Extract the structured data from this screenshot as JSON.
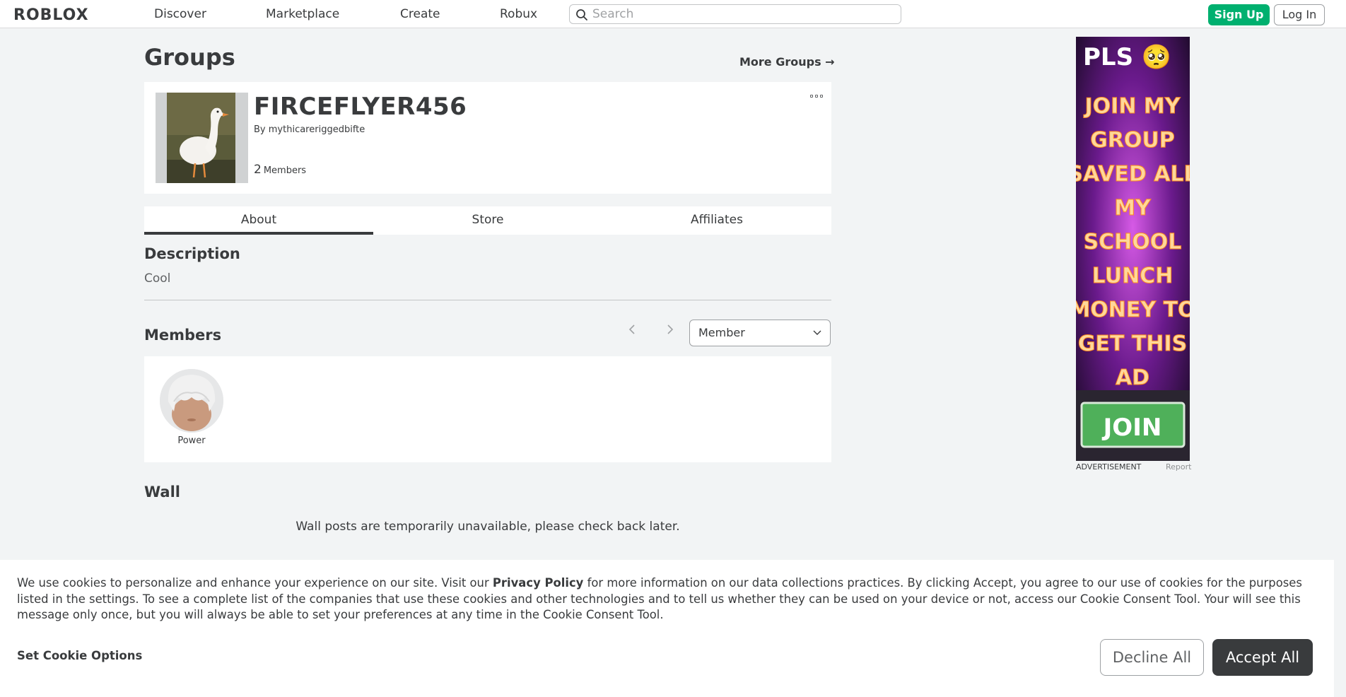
{
  "header": {
    "logo": "ROBLOX",
    "nav": [
      "Discover",
      "Marketplace",
      "Create",
      "Robux"
    ],
    "search_placeholder": "Search",
    "signup_label": "Sign Up",
    "login_label": "Log In"
  },
  "page": {
    "title": "Groups",
    "more_groups": "More Groups →"
  },
  "group": {
    "name": "FIRCEFLYER456",
    "by_prefix": "By",
    "owner": "mythicareriggedbifte",
    "member_count": "2",
    "member_label": "Members"
  },
  "tabs": [
    "About",
    "Store",
    "Affiliates"
  ],
  "about": {
    "description_heading": "Description",
    "description": "Cool",
    "members_heading": "Members",
    "role_filter": "Member",
    "members": [
      {
        "name": "Power"
      }
    ],
    "wall_heading": "Wall",
    "wall_message": "Wall posts are temporarily unavailable, please check back later."
  },
  "ad": {
    "headline": "PLS 🥺",
    "lines": [
      "JOIN MY",
      "GROUP",
      "SAVED ALL",
      "MY",
      "SCHOOL",
      "LUNCH",
      "MONEY TO",
      "GET THIS",
      "AD"
    ],
    "button": "JOIN",
    "label": "ADVERTISEMENT",
    "report": "Report"
  },
  "cookie_banner": {
    "text_before": "We use cookies to personalize and enhance your experience on our site. Visit our ",
    "privacy_link": "Privacy Policy",
    "text_after": " for more information on our data collections practices. By clicking Accept, you agree to our use of cookies for the purposes listed in the settings. To see a complete list of the companies that use these cookies and other technologies and to tell us whether they can be used on your device or not, access our Cookie Consent Tool. Your will see this message only once, but you will always be able to set your preferences at any time in the Cookie Consent Tool.",
    "set_options": "Set Cookie Options",
    "decline": "Decline All",
    "accept": "Accept All"
  },
  "colors": {
    "background": "#f2f4f5",
    "primary_green": "#00b06f",
    "text": "#393b3d",
    "accept_button": "#393b3d"
  }
}
